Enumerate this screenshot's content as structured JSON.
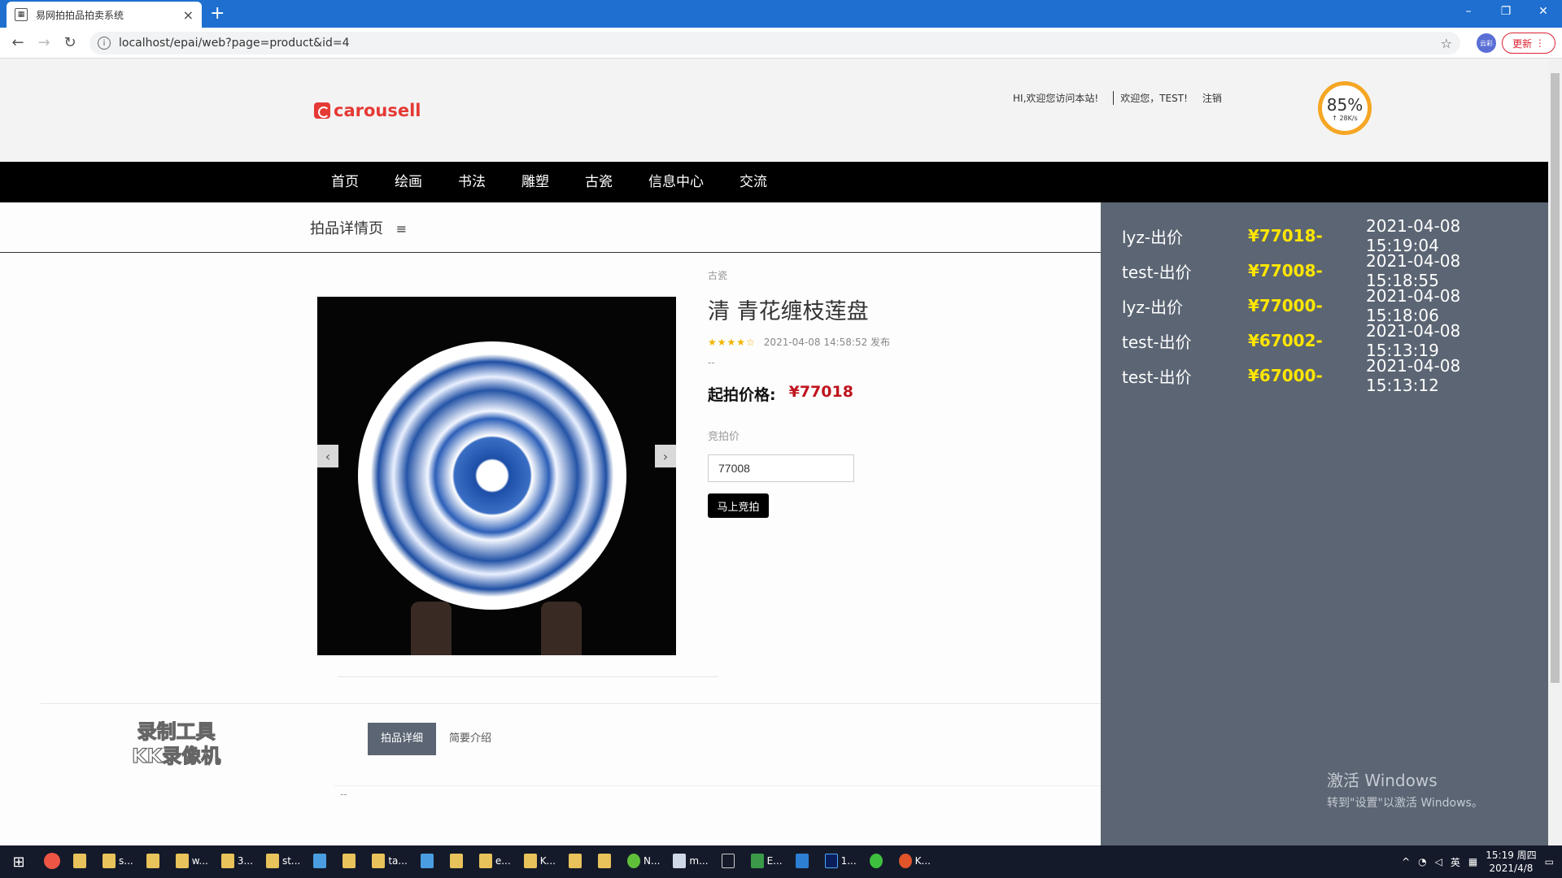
{
  "browser": {
    "tab_title": "易网拍拍品拍卖系统",
    "tab_close": "×",
    "new_tab": "+",
    "url": "localhost/epai/web?page=product&id=4",
    "update_label": "更新",
    "profile_label": "云彩",
    "window_controls": [
      "–",
      "❐",
      "✕"
    ]
  },
  "header": {
    "logo_text": "carousell",
    "welcome": "HI,欢迎您访问本站!",
    "user_greeting": "欢迎您，TEST!",
    "logout": "注销",
    "speed_percent": "85%",
    "speed_rate": "↑ 28K/s"
  },
  "nav": {
    "items": [
      "首页",
      "绘画",
      "书法",
      "雕塑",
      "古瓷",
      "信息中心",
      "交流"
    ]
  },
  "breadcrumb": {
    "label": "拍品详情页",
    "menu_icon": "≡"
  },
  "product": {
    "category": "古瓷",
    "title": "清 青花缠枝莲盘",
    "stars": "★★★★☆",
    "published": "2021-04-08 14:58:52 发布",
    "dash": "--",
    "start_price_label": "起拍价格:",
    "start_price_value": "¥77018",
    "bid_label": "竞拍价",
    "bid_value": "77008",
    "bid_button": "马上竞拍",
    "prev_arrow": "‹",
    "next_arrow": "›"
  },
  "bottom_tabs": {
    "items": [
      "拍品详细",
      "简要介绍"
    ],
    "dash": "--"
  },
  "recorder_watermark": [
    "录制工具",
    "KK录像机"
  ],
  "bid_history": [
    {
      "who": "lyz-出价",
      "amount": "¥77018-",
      "time": "2021-04-08 15:19:04"
    },
    {
      "who": "test-出价",
      "amount": "¥77008-",
      "time": "2021-04-08 15:18:55"
    },
    {
      "who": "lyz-出价",
      "amount": "¥77000-",
      "time": "2021-04-08 15:18:06"
    },
    {
      "who": "test-出价",
      "amount": "¥67002-",
      "time": "2021-04-08 15:13:19"
    },
    {
      "who": "test-出价",
      "amount": "¥67000-",
      "time": "2021-04-08 15:13:12"
    }
  ],
  "activation": {
    "line1": "激活 Windows",
    "line2": "转到\"设置\"以激活 Windows。"
  },
  "taskbar": {
    "items": [
      "",
      "s...",
      "",
      "w...",
      "3...",
      "st...",
      "",
      "",
      "ta...",
      "",
      "",
      "e...",
      "K...",
      "",
      "",
      "N...",
      "m...",
      "",
      "E...",
      "",
      "1...",
      "",
      "K..."
    ],
    "ime": "英",
    "time": "15:19 周四",
    "date": "2021/4/8"
  }
}
